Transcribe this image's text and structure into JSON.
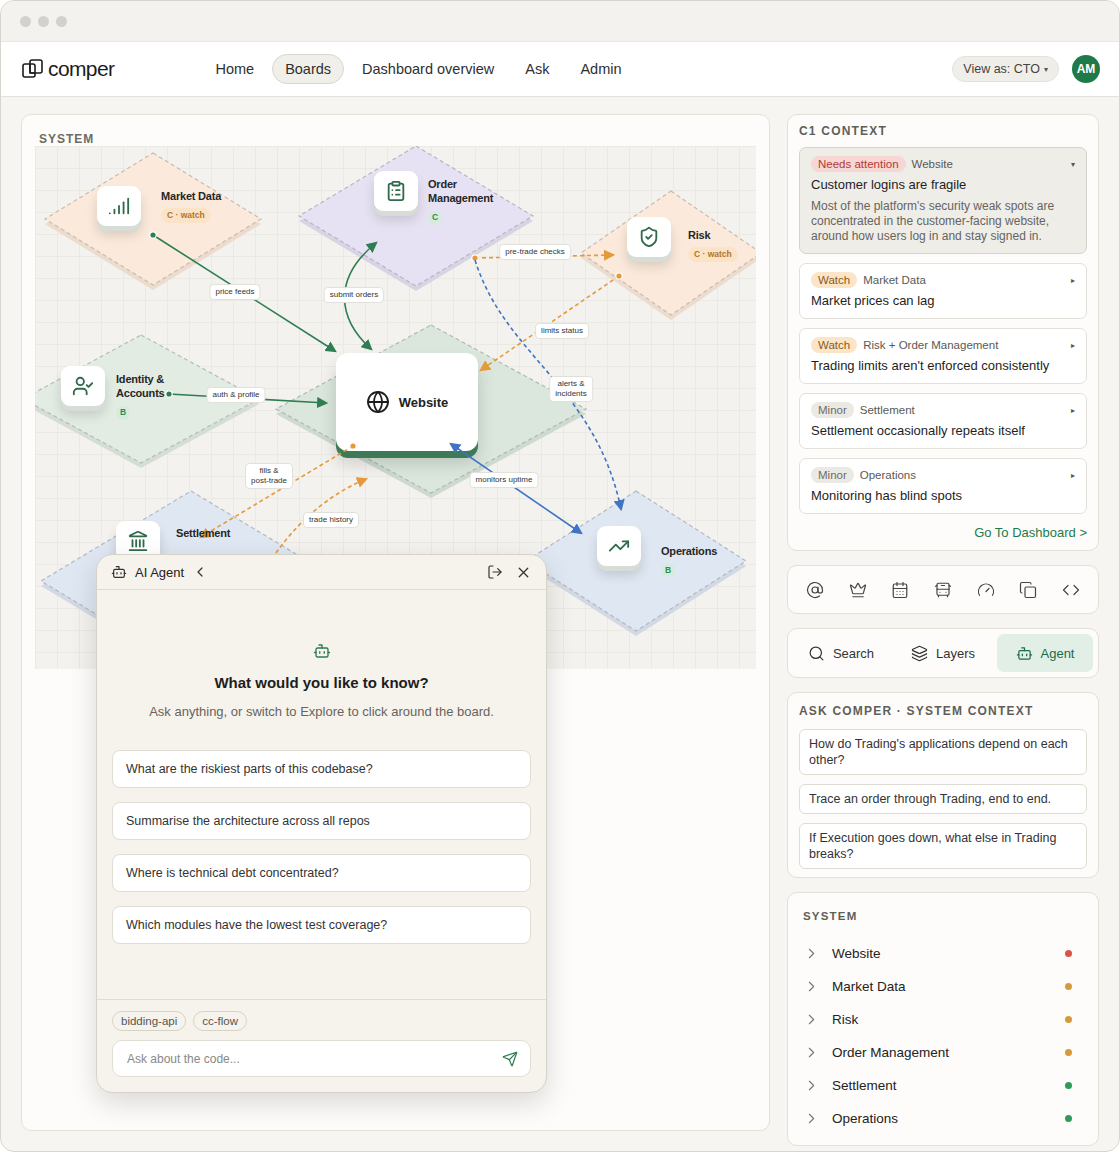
{
  "nav": {
    "logo": "comper",
    "items": [
      {
        "label": "Home",
        "selected": false
      },
      {
        "label": "Boards",
        "selected": true
      },
      {
        "label": "Dashboard overview",
        "selected": false
      },
      {
        "label": "Ask",
        "selected": false
      },
      {
        "label": "Admin",
        "selected": false
      }
    ],
    "view_as": {
      "label": "View as: CTO",
      "caret": "▾"
    },
    "avatar": "AM"
  },
  "board": {
    "title": "SYSTEM",
    "nodes": [
      {
        "label": "Market Data",
        "badge": "C · watch",
        "status": "watch",
        "color": "#fbeadb"
      },
      {
        "label": "Order Management",
        "badge": "C",
        "status": "ok",
        "color": "#e7e2f3"
      },
      {
        "label": "Risk",
        "badge": "C · watch",
        "status": "watch",
        "color": "#fbeadb"
      },
      {
        "label": "Identity & Accounts",
        "badge": "B",
        "status": "ok",
        "color": "#e2ece3"
      },
      {
        "label": "Website",
        "color": "#dbe7dc"
      },
      {
        "label": "Settlement",
        "color": "#dfe7f2"
      },
      {
        "label": "Operations",
        "badge": "B",
        "status": "ok",
        "color": "#dfe7f2"
      }
    ],
    "edges": [
      {
        "label": "price feeds",
        "color": "#2f7d52",
        "dashed": false,
        "two_way": false
      },
      {
        "label": "submit orders",
        "color": "#2f7d52",
        "dashed": false,
        "two_way": true
      },
      {
        "label": "pre-trade checks",
        "color": "#e39a3b",
        "dashed": true,
        "two_way": false
      },
      {
        "label": "limits status",
        "color": "#e39a3b",
        "dashed": true,
        "two_way": false
      },
      {
        "label": "alerts &\nincidents",
        "color": "#3f74c4",
        "dashed": true,
        "two_way": false
      },
      {
        "label": "auth & profile",
        "color": "#2f7d52",
        "dashed": false,
        "two_way": false
      },
      {
        "label": "fills &\npost-trade",
        "color": "#e39a3b",
        "dashed": true,
        "two_way": false
      },
      {
        "label": "trade history",
        "color": "#e39a3b",
        "dashed": true,
        "two_way": false
      },
      {
        "label": "monitors uptime",
        "color": "#3f74c4",
        "dashed": false,
        "two_way": true
      }
    ]
  },
  "agent": {
    "title": "AI Agent",
    "heading": "What would you like to know?",
    "subtitle": "Ask anything, or switch to Explore to click around the board.",
    "suggestions": [
      "What are the riskiest parts of this codebase?",
      "Summarise the architecture across all repos",
      "Where is technical debt concentrated?",
      "Which modules have the lowest test coverage?"
    ],
    "chips": [
      "bidding-api",
      "cc-flow"
    ],
    "input": {
      "placeholder": "Ask about the code..."
    }
  },
  "context": {
    "title": "C1 CONTEXT",
    "items": [
      {
        "badge": "Needs attention",
        "severity": "attention",
        "area": "Website",
        "caret": "▾",
        "expanded": true,
        "title": "Customer logins are fragile",
        "description": "Most of the platform's security weak spots are concentrated in the customer-facing website, around how users log in and stay signed in."
      },
      {
        "badge": "Watch",
        "severity": "watch",
        "area": "Market Data",
        "caret": "▸",
        "expanded": false,
        "title": "Market prices can lag"
      },
      {
        "badge": "Watch",
        "severity": "watch",
        "area": "Risk + Order Management",
        "caret": "▸",
        "expanded": false,
        "title": "Trading limits aren't enforced consistently"
      },
      {
        "badge": "Minor",
        "severity": "minor",
        "area": "Settlement",
        "caret": "▸",
        "expanded": false,
        "title": "Settlement occasionally repeats itself"
      },
      {
        "badge": "Minor",
        "severity": "minor",
        "area": "Operations",
        "caret": "▸",
        "expanded": false,
        "title": "Monitoring has blind spots"
      }
    ],
    "link": "Go To Dashboard >"
  },
  "panel_tabs": [
    {
      "label": "Search",
      "selected": false
    },
    {
      "label": "Layers",
      "selected": false
    },
    {
      "label": "Agent",
      "selected": true
    }
  ],
  "ask": {
    "title": "ASK COMPER · SYSTEM CONTEXT",
    "questions": [
      "How do Trading's applications depend on each other?",
      "Trace an order through Trading, end to end.",
      "If Execution goes down, what else in Trading breaks?"
    ]
  },
  "system": {
    "title": "SYSTEM",
    "items": [
      {
        "name": "Website",
        "color": "#d9534a"
      },
      {
        "name": "Market Data",
        "color": "#d49a3e"
      },
      {
        "name": "Risk",
        "color": "#d49a3e"
      },
      {
        "name": "Order Management",
        "color": "#d49a3e"
      },
      {
        "name": "Settlement",
        "color": "#2f9a5c"
      },
      {
        "name": "Operations",
        "color": "#2f9a5c"
      }
    ]
  }
}
